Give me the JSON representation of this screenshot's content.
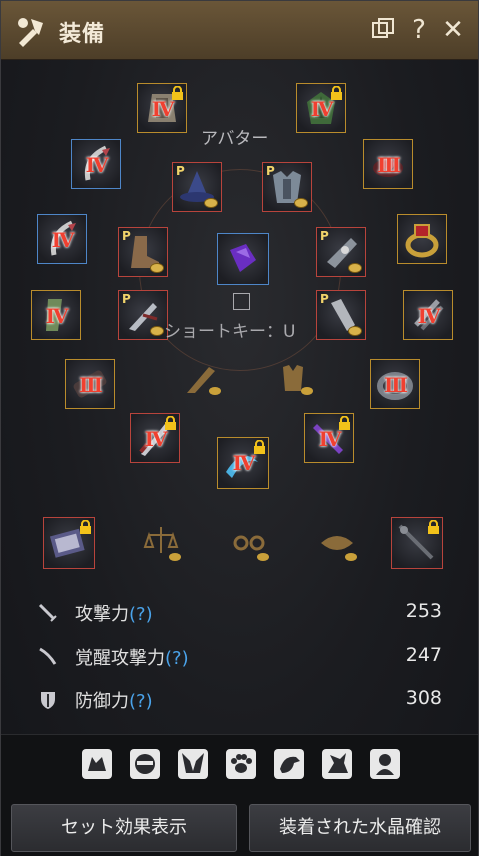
{
  "window": {
    "title": "装備",
    "icons": [
      "equipment-icon",
      "popout-icon",
      "help-icon",
      "close-icon"
    ],
    "help_glyph": "?",
    "close_glyph": "✕"
  },
  "avatar": {
    "label": "アバター",
    "shortcut_label": "ショートキー：U"
  },
  "slots": [
    {
      "name": "slot-avatar-helmet",
      "level": "IV",
      "locked": true,
      "color": "gold"
    },
    {
      "name": "slot-avatar-armor",
      "level": "IV",
      "locked": true,
      "color": "gold"
    },
    {
      "name": "slot-earring-left",
      "level": "IV",
      "locked": false,
      "color": "blue"
    },
    {
      "name": "slot-helmet",
      "level": "",
      "pearl": "P",
      "color": "red"
    },
    {
      "name": "slot-armor",
      "level": "",
      "pearl": "P",
      "color": "red"
    },
    {
      "name": "slot-necklace",
      "level": "III",
      "locked": false,
      "color": "gold"
    },
    {
      "name": "slot-earring-right",
      "level": "IV",
      "locked": false,
      "color": "blue"
    },
    {
      "name": "slot-boots",
      "level": "",
      "pearl": "P",
      "color": "red"
    },
    {
      "name": "slot-crystal",
      "level": "",
      "color": "blue"
    },
    {
      "name": "slot-gloves",
      "level": "",
      "pearl": "P",
      "color": "red"
    },
    {
      "name": "slot-ring-right",
      "level": "",
      "color": "gold"
    },
    {
      "name": "slot-ring-left",
      "level": "IV",
      "locked": false,
      "color": "gold"
    },
    {
      "name": "slot-avatar-shoes",
      "level": "",
      "pearl": "P",
      "color": "red"
    },
    {
      "name": "slot-avatar-gloves",
      "level": "",
      "pearl": "P",
      "color": "red"
    },
    {
      "name": "slot-ring-right-2",
      "level": "IV",
      "locked": false,
      "color": "gold"
    },
    {
      "name": "slot-belt",
      "level": "III",
      "locked": false,
      "color": "gold"
    },
    {
      "name": "slot-belt-right",
      "level": "III",
      "locked": false,
      "color": "gold"
    },
    {
      "name": "slot-main-weapon",
      "level": "IV",
      "locked": true,
      "color": "red"
    },
    {
      "name": "slot-awakening-weapon",
      "level": "IV",
      "locked": true,
      "color": "gold"
    },
    {
      "name": "slot-sub-weapon",
      "level": "IV",
      "locked": true,
      "color": "gold"
    },
    {
      "name": "slot-lifeskill-tool",
      "level": "",
      "locked": true,
      "color": "red"
    },
    {
      "name": "slot-fishing-rod",
      "level": "",
      "locked": true,
      "color": "red"
    }
  ],
  "stats": {
    "attack": {
      "label": "攻撃力",
      "q": "(?)",
      "value": "253"
    },
    "awakening": {
      "label": "覚醒攻撃力",
      "q": "(?)",
      "value": "247"
    },
    "defense": {
      "label": "防御力",
      "q": "(?)",
      "value": "308"
    }
  },
  "pets": [
    "pet-cat-icon",
    "pet-ninja-icon",
    "pet-fox-icon",
    "pet-paw-icon",
    "pet-bird-icon",
    "pet-dragon-icon",
    "pet-ghost-icon"
  ],
  "buttons": {
    "set_effects": "セット効果表示",
    "crystals": "装着された水晶確認"
  }
}
